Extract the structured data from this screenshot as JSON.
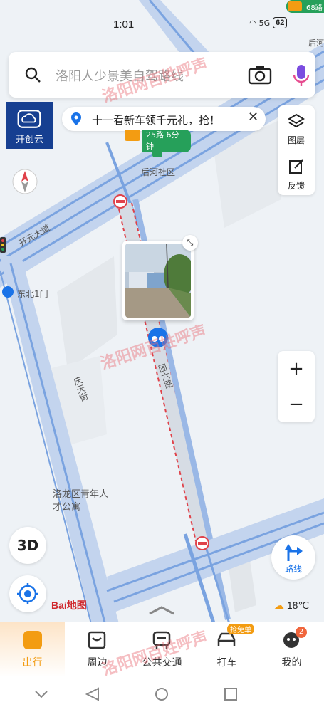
{
  "status": {
    "time": "1:01",
    "net": "5G",
    "battery": "62"
  },
  "search": {
    "placeholder": "洛阳人少景美自驾路线"
  },
  "kaichuang": {
    "label": "开创云"
  },
  "banner": {
    "text": "十一看新车领千元礼，抢！",
    "close": "✕"
  },
  "right_panel": {
    "layers": "图层",
    "feedback": "反馈"
  },
  "corner_bus": {
    "text": "68路",
    "stop": "后河"
  },
  "bus_tag": {
    "text": "25路 6分钟"
  },
  "map_labels": {
    "stop": "后河社区",
    "avenue": "开元大道",
    "gate": "东北1门",
    "road1": "固六路",
    "road2": "庆天街",
    "poi": "洛龙区青年人才公寓"
  },
  "zoom": {
    "plus": "+",
    "minus": "−"
  },
  "buttons": {
    "three_d": "3D",
    "route": "路线"
  },
  "weather": {
    "temp": "18℃"
  },
  "baidu": {
    "logo": "Bai地图"
  },
  "tabs": [
    {
      "label": "出行",
      "icon": "travel-icon",
      "active": true
    },
    {
      "label": "周边",
      "icon": "nearby-icon"
    },
    {
      "label": "公共交通",
      "icon": "bus-icon"
    },
    {
      "label": "打车",
      "icon": "taxi-icon",
      "badge": "抢免单"
    },
    {
      "label": "我的",
      "icon": "profile-icon",
      "badge": "2"
    }
  ],
  "watermark": "洛阳网百姓呼声",
  "colors": {
    "accent": "#1a73e8",
    "road": "#a9c5ee",
    "route_dash": "#e0424a",
    "brand_blue": "#163f91",
    "orange": "#f39c12"
  }
}
